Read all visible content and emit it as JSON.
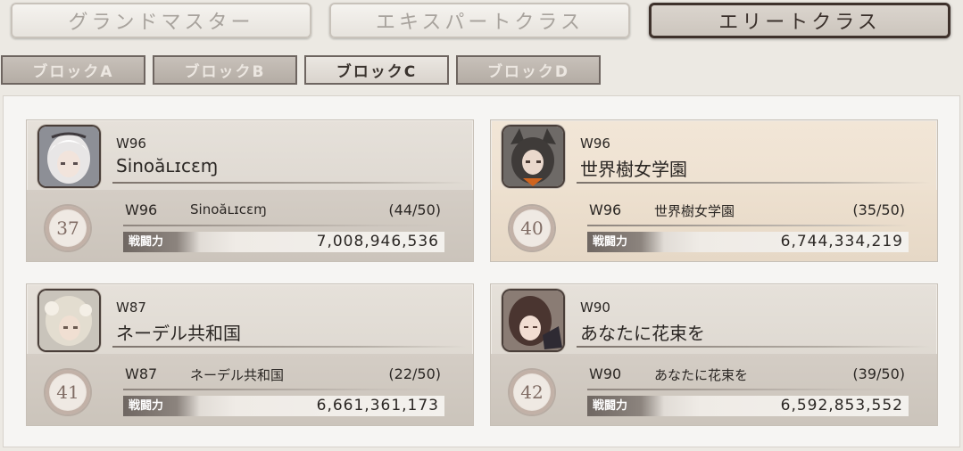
{
  "tabs": [
    {
      "label": "グランドマスター",
      "active": false
    },
    {
      "label": "エキスパートクラス",
      "active": false
    },
    {
      "label": "エリートクラス",
      "active": true
    }
  ],
  "blocks": [
    {
      "label": "ブロックA",
      "active": false
    },
    {
      "label": "ブロックB",
      "active": false
    },
    {
      "label": "ブロックC",
      "active": true
    },
    {
      "label": "ブロックD",
      "active": false
    }
  ],
  "power_label": "戦闘力",
  "cards": [
    {
      "world": "W96",
      "name": "Sinoăʟɪcɛɱ",
      "rank": "37",
      "count": "(44/50)",
      "power": "7,008,946,536",
      "highlight": false
    },
    {
      "world": "W96",
      "name": "世界樹女学園",
      "rank": "40",
      "count": "(35/50)",
      "power": "6,744,334,219",
      "highlight": true
    },
    {
      "world": "W87",
      "name": "ネーデル共和国",
      "rank": "41",
      "count": "(22/50)",
      "power": "6,661,361,173",
      "highlight": false
    },
    {
      "world": "W90",
      "name": "あなたに花束を",
      "rank": "42",
      "count": "(39/50)",
      "power": "6,592,853,552",
      "highlight": false
    }
  ]
}
